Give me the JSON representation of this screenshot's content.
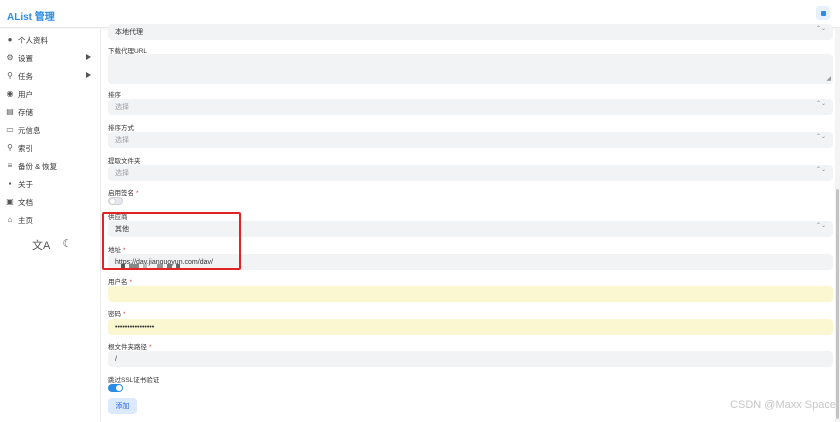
{
  "header": {
    "brand": "AList 管理"
  },
  "sidebar": {
    "items": [
      {
        "icon": "person-icon",
        "glyph": "●",
        "label": "个人资料",
        "arrow": false
      },
      {
        "icon": "gear-icon",
        "glyph": "⚙",
        "label": "设置",
        "arrow": true
      },
      {
        "icon": "tasks-icon",
        "glyph": "⚲",
        "label": "任务",
        "arrow": true
      },
      {
        "icon": "user-icon",
        "glyph": "◉",
        "label": "用户",
        "arrow": false
      },
      {
        "icon": "storage-icon",
        "glyph": "▤",
        "label": "存储",
        "arrow": false
      },
      {
        "icon": "meta-icon",
        "glyph": "▭",
        "label": "元信息",
        "arrow": false
      },
      {
        "icon": "search-icon",
        "glyph": "⚲",
        "label": "索引",
        "arrow": false
      },
      {
        "icon": "database-icon",
        "glyph": "≡",
        "label": "备份 & 恢复",
        "arrow": false
      },
      {
        "icon": "about-icon",
        "glyph": "▪",
        "label": "关于",
        "arrow": false
      },
      {
        "icon": "docs-icon",
        "glyph": "▣",
        "label": "文档",
        "arrow": false
      },
      {
        "icon": "home-icon",
        "glyph": "⌂",
        "label": "主页",
        "arrow": false
      }
    ],
    "tools": {
      "translate_glyph": "文A",
      "theme_glyph": "☾"
    }
  },
  "form": {
    "proxy_value": "本地代理",
    "download_url_label": "下载代理URL",
    "sort_label": "排序",
    "sort_placeholder": "选择",
    "sort_dir_label": "排序方式",
    "sort_dir_placeholder": "选择",
    "extract_label": "提取文件夹",
    "extract_placeholder": "选择",
    "sign_label": "启用签名",
    "sign_enabled": false,
    "vendor_label": "供应商",
    "vendor_value": "其他",
    "address_label": "地址",
    "address_value": "https://dav.jianguoyun.com/dav/",
    "username_label": "用户名",
    "password_label": "密码",
    "password_value": "••••••••••••••••",
    "root_label": "根文件夹路径",
    "root_value": "/",
    "tls_label": "跳过SSL证书验证",
    "tls_skip": true,
    "required_mark": "*",
    "select_arrows": "⌃⌄",
    "add_button": "添加"
  },
  "watermark": "CSDN @Maxx Space"
}
